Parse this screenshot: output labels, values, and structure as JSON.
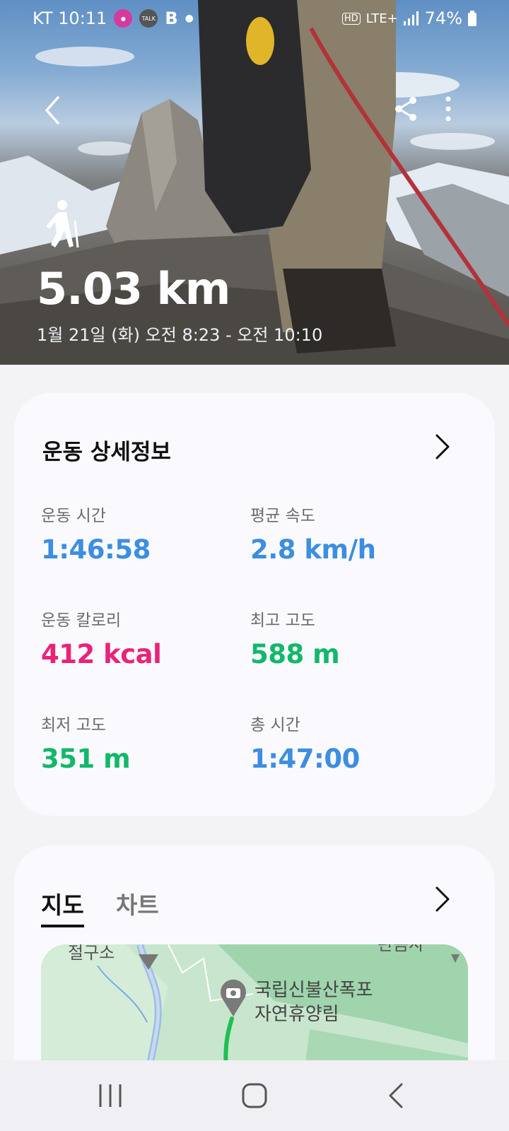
{
  "status_bar": {
    "carrier_time": "KT 10:11",
    "talk_label": "TALK",
    "b_label": "B",
    "hd_label": "HD",
    "network": "LTE+",
    "battery": "74%"
  },
  "hero": {
    "distance": "5.03 km",
    "date_range": "1월 21일 (화) 오전 8:23 - 오전 10:10"
  },
  "details": {
    "title": "운동 상세정보",
    "stats": [
      {
        "label": "운동 시간",
        "value": "1:46:58"
      },
      {
        "label": "평균 속도",
        "value": "2.8 km/h"
      },
      {
        "label": "운동 칼로리",
        "value": "412 kcal"
      },
      {
        "label": "최고 고도",
        "value": "588 m"
      },
      {
        "label": "최저 고도",
        "value": "351 m"
      },
      {
        "label": "총 시간",
        "value": "1:47:00"
      }
    ]
  },
  "map_section": {
    "tabs": [
      "지도",
      "차트"
    ],
    "map_labels": {
      "top_left": "절구소",
      "top_right": "관음사",
      "place_line1": "국립신불산폭포",
      "place_line2": "자연휴양림"
    }
  },
  "colors": {
    "time_blue": "#3d8ee0",
    "calorie_pink": "#e8237a",
    "altitude_green": "#12b86a"
  }
}
